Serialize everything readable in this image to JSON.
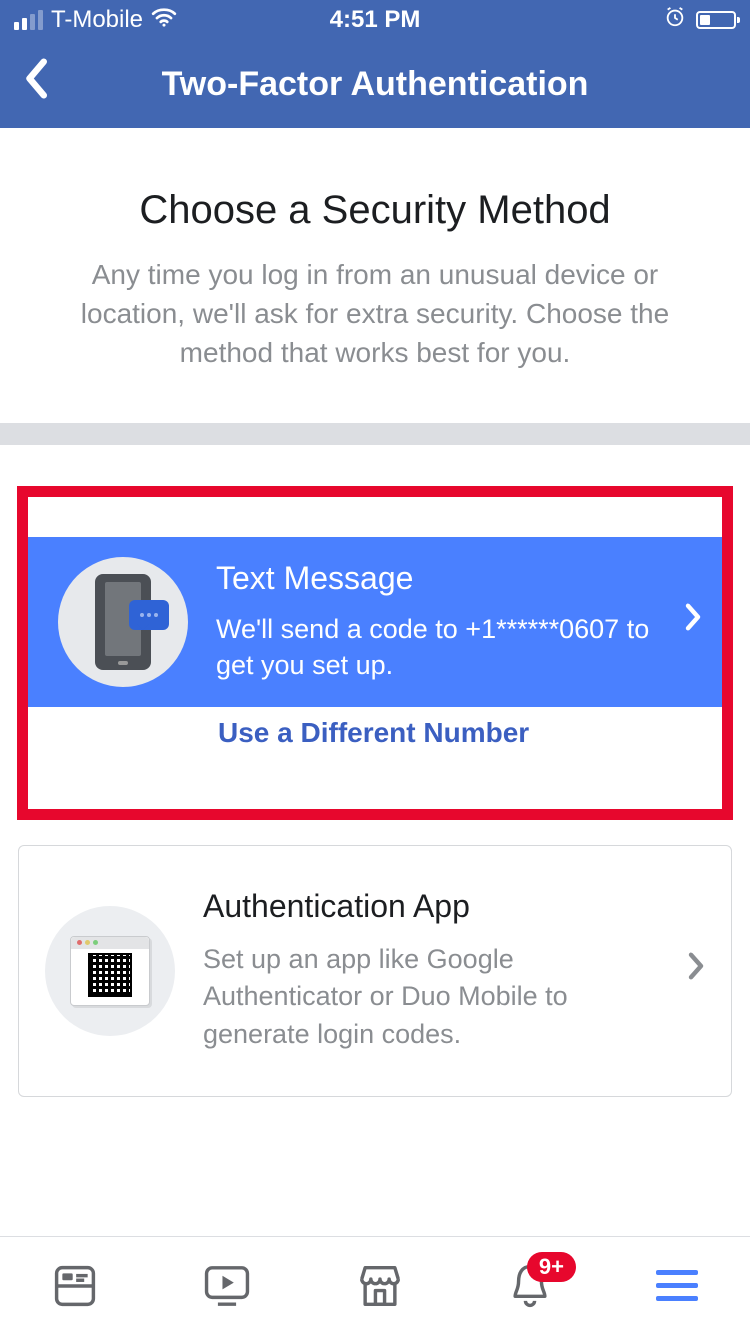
{
  "status": {
    "carrier": "T-Mobile",
    "time": "4:51 PM"
  },
  "header": {
    "title": "Two-Factor Authentication"
  },
  "intro": {
    "heading": "Choose a Security Method",
    "body": "Any time you log in from an unusual device or location, we'll ask for extra security. Choose the method that works best for you."
  },
  "options": {
    "sms": {
      "title": "Text Message",
      "desc": "We'll send a code to +1******0607 to get you set up.",
      "alt_link": "Use a Different Number"
    },
    "app": {
      "title": "Authentication App",
      "desc": "Set up an app like Google Authenticator or Duo Mobile to generate login codes."
    }
  },
  "tabbar": {
    "notification_badge": "9+"
  }
}
